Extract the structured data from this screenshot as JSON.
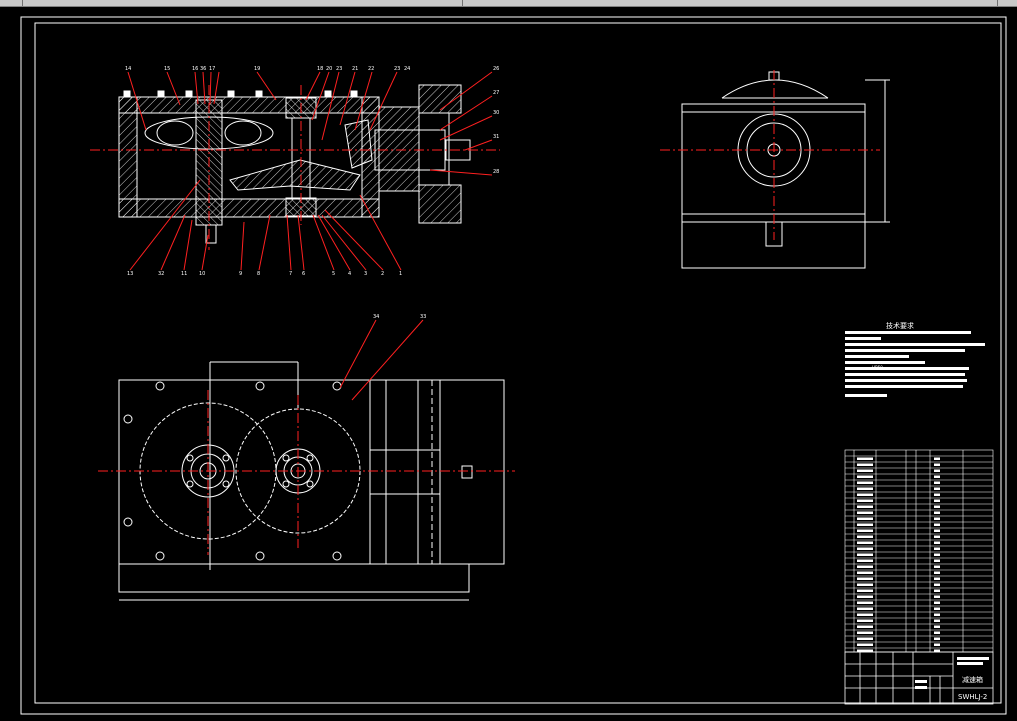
{
  "window": {
    "toolbar_segments": 4
  },
  "colors": {
    "background": "#000000",
    "line": "#ffffff",
    "leader": "#ff2020",
    "dim": "#ff2020"
  },
  "front_view": {
    "callouts_top": [
      "14",
      "15",
      "16",
      "36",
      "17",
      "19",
      "18",
      "20",
      "23",
      "21",
      "22",
      "23",
      "24"
    ],
    "callouts_right": [
      "26",
      "27",
      "30",
      "31",
      "28"
    ],
    "callouts_bottom": [
      "13",
      "32",
      "11",
      "10",
      "9",
      "8",
      "7",
      "6",
      "5",
      "4",
      "3",
      "2",
      "1"
    ]
  },
  "plan_view": {
    "callouts": [
      "34",
      "33"
    ]
  },
  "notes": {
    "title": "技术要求",
    "line_mark": "HB50"
  },
  "title_block": {
    "name": "减速箱",
    "drawing_no": "SWHLJ-2"
  }
}
